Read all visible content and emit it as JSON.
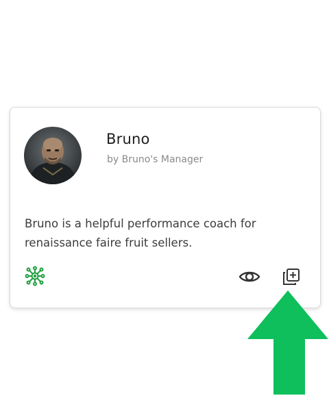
{
  "card": {
    "name": "Bruno",
    "author": "by Bruno's Manager",
    "description": "Bruno is a helpful performance coach for renaissance faire fruit sellers."
  },
  "icons": {
    "type_icon": "network-nodes-icon",
    "view_icon": "eye-icon",
    "duplicate_icon": "duplicate-icon",
    "annotation": "green-up-arrow-icon"
  },
  "colors": {
    "accent_green": "#1e9e3e",
    "arrow_green": "#0ebf5c",
    "icon_gray": "#333333"
  }
}
